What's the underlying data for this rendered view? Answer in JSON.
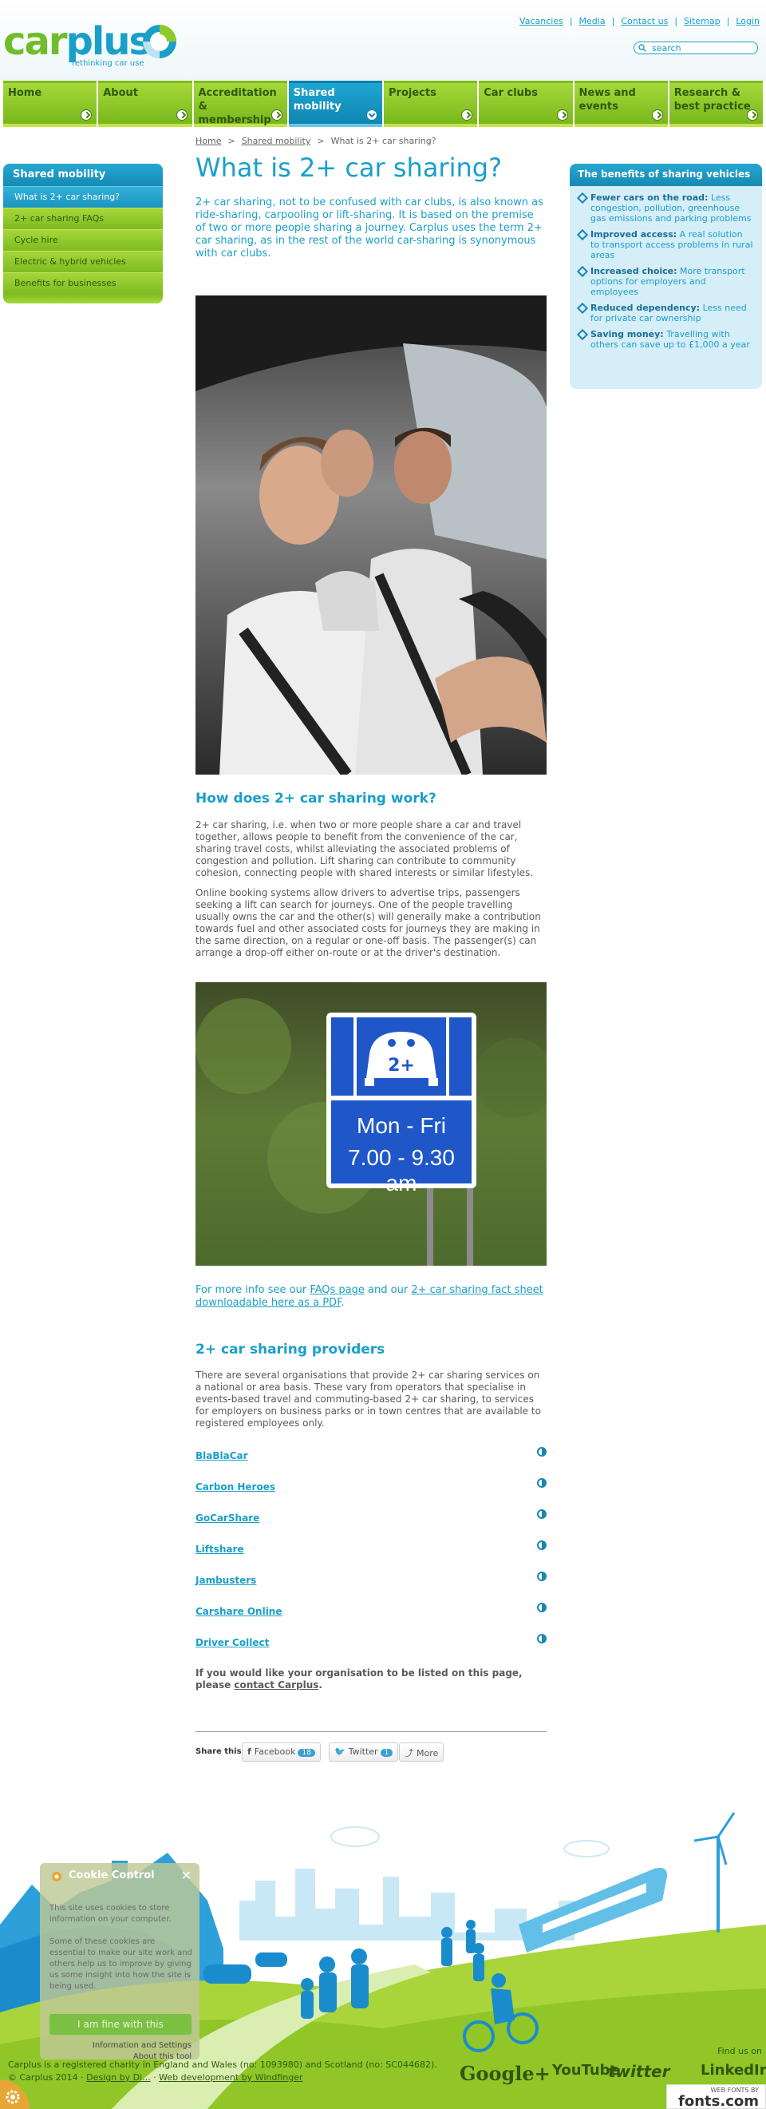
{
  "brand": {
    "logo_car": "car",
    "logo_plus": "plus",
    "tagline": "rethinking car use",
    "colors": {
      "blue": "#1a9fc9",
      "green": "#8ecb2a",
      "dark_green": "#2f5a08"
    }
  },
  "toplinks": [
    "Vacancies",
    "Media",
    "Contact us",
    "Sitemap",
    "Login"
  ],
  "search": {
    "placeholder": "search"
  },
  "nav": [
    {
      "label": "Home",
      "active": false
    },
    {
      "label": "About",
      "active": false
    },
    {
      "label": "Accreditation & membership",
      "active": false
    },
    {
      "label": "Shared mobility",
      "active": true
    },
    {
      "label": "Projects",
      "active": false
    },
    {
      "label": "Car clubs",
      "active": false
    },
    {
      "label": "News and events",
      "active": false
    },
    {
      "label": "Research & best practice",
      "active": false
    }
  ],
  "sidebar": {
    "title": "Shared mobility",
    "items": [
      {
        "label": "What is 2+ car sharing?",
        "active": true
      },
      {
        "label": "2+ car sharing FAQs",
        "active": false
      },
      {
        "label": "Cycle hire",
        "active": false
      },
      {
        "label": "Electric & hybrid vehicles",
        "active": false
      },
      {
        "label": "Benefits for businesses",
        "active": false
      }
    ]
  },
  "breadcrumb": {
    "home": "Home",
    "section": "Shared mobility",
    "current": "What is 2+ car sharing?",
    "separator": ">"
  },
  "page": {
    "title": "What is 2+ car sharing?",
    "intro": "2+ car sharing, not to be confused with car clubs, is also known as ride-sharing, carpooling or lift-sharing. It is based on the premise of two or more people sharing a journey. Carplus uses the term 2+ car sharing, as in the rest of the world car-sharing is synonymous with car clubs.",
    "how_heading": "How does 2+ car sharing work?",
    "how_p1": "2+ car sharing, i.e. when two or more people share a car and travel together, allows people to benefit from the convenience of the car, sharing travel costs, whilst alleviating the associated problems of congestion and pollution. Lift sharing can contribute to community cohesion, connecting people with shared interests or similar lifestyles.",
    "how_p2": "Online booking systems allow drivers to advertise trips, passengers seeking a lift can search for journeys. One of the people travelling usually owns the car and the other(s) will generally make a contribution towards fuel and other associated costs for journeys they are making in the same direction, on a regular or one-off basis. The passenger(s) can arrange a drop-off either on-route or at the driver's destination.",
    "sign_badge": "2+",
    "sign_days": "Mon - Fri",
    "sign_hours": "7.00 - 9.30 am",
    "more_prefix": "For more info see our ",
    "more_link1": "FAQs page",
    "more_mid": " and our ",
    "more_link2": "2+ car sharing fact sheet downloadable here as a PDF",
    "more_suffix": ".",
    "providers_heading": "2+ car sharing providers",
    "providers_intro": "There are several organisations that provide 2+ car sharing services on a national or area basis. These vary from operators that specialise in events-based travel and commuting-based 2+ car sharing, to services for employers on business parks or in town centres that are available to registered employees only.",
    "providers": [
      "BlaBlaCar",
      "Carbon Heroes",
      "GoCarShare",
      "Liftshare",
      "Jambusters",
      "Carshare Online",
      "Driver Collect"
    ],
    "listed_prefix": "If you would like your organisation to be listed on this page, please ",
    "listed_link": "contact Carplus",
    "listed_suffix": "."
  },
  "share": {
    "label": "Share this:",
    "facebook": "Facebook",
    "facebook_count": "18",
    "twitter": "Twitter",
    "twitter_count": "1",
    "more": "More"
  },
  "benefits": {
    "title": "The benefits of sharing vehicles",
    "items": [
      {
        "term": "Fewer cars on the road:",
        "desc": "Less congestion, pollution, greenhouse gas emissions and parking problems"
      },
      {
        "term": "Improved access:",
        "desc": "A real solution to transport access problems in rural areas"
      },
      {
        "term": "Increased choice:",
        "desc": "More transport options for employers and employees"
      },
      {
        "term": "Reduced dependency:",
        "desc": "Less need for private car ownership"
      },
      {
        "term": "Saving money:",
        "desc": "Travelling with others can save up to £1,000 a year"
      }
    ]
  },
  "footer": {
    "line1": "Carplus is a registered charity in England and Wales (no: 1093980) and Scotland (no: SC044682).",
    "line2_prefix": "© Carplus 2014 · ",
    "design_link": "Design by Di...",
    "dev_link": "Web development by Windfinger",
    "find_us": "Find us on",
    "social": [
      "Google+",
      "YouTube",
      "twitter",
      "LinkedIn"
    ],
    "fonts_small": "WEB FONTS BY",
    "fonts_big": "fonts.com"
  },
  "cookie": {
    "title": "Cookie Control",
    "close": "✕",
    "msg1": "This site uses cookies to store information on your computer.",
    "msg2": "Some of these cookies are essential to make our site work and others help us to improve by giving us some insight into how the site is being used.",
    "accept": "I am fine with this",
    "settings": "Information and Settings",
    "about": "About this tool"
  }
}
